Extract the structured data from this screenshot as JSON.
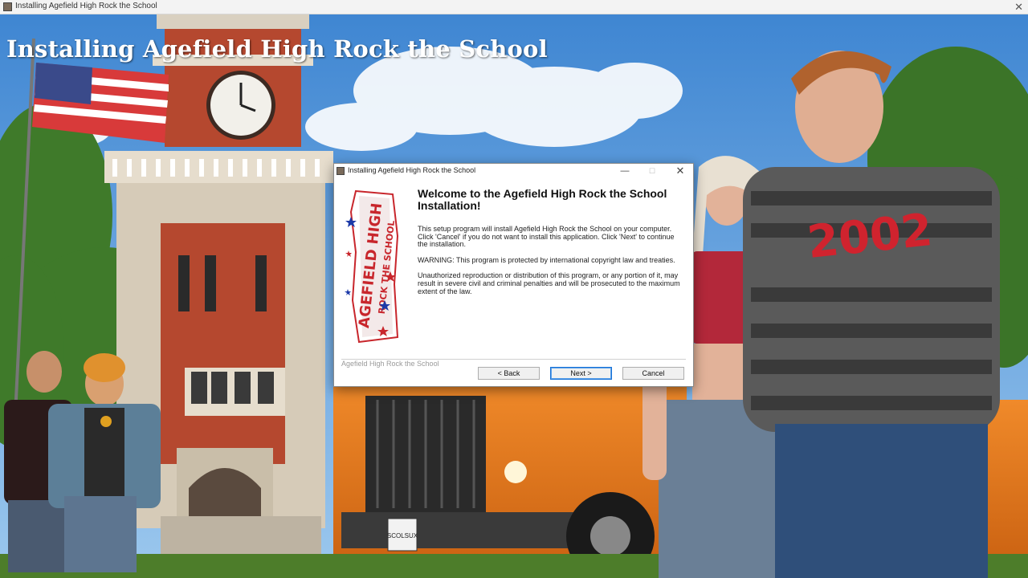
{
  "window": {
    "title": "Installing Agefield High Rock the School",
    "close_glyph": "✕"
  },
  "banner": {
    "title": "Installing Agefield High Rock the School"
  },
  "background": {
    "description_tags": [
      "clock-tower",
      "american-flag",
      "school-bus",
      "students"
    ],
    "license_plate": "SCOLSUX",
    "shirt_text": "2002"
  },
  "dialog": {
    "title": "Installing Agefield High Rock the School",
    "controls": {
      "minimize": "—",
      "maximize": "☐",
      "close": "✕"
    },
    "logo": {
      "line1": "AGEFIELD HIGH",
      "line2": "ROCK THE SCHOOL"
    },
    "heading": "Welcome to the Agefield High Rock the School Installation!",
    "paragraphs": {
      "intro": "This setup program will install Agefield High Rock the School on your computer. Click 'Cancel' if you do not want to install this application. Click 'Next' to continue the installation.",
      "warning": "WARNING: This program is protected by international copyright law and treaties.",
      "legal": "Unauthorized reproduction or distribution of this program, or any portion of it, may result in severe civil and criminal penalties and will be prosecuted to the maximum extent of the law."
    },
    "brand_label": "Agefield High Rock the School",
    "buttons": {
      "back": "< Back",
      "next": "Next >",
      "cancel": "Cancel"
    }
  },
  "colors": {
    "sky": "#5a9bd8",
    "brick": "#b5482f",
    "bus_orange": "#e8791c",
    "logo_red": "#c8262c",
    "default_button_border": "#1a73d6"
  }
}
